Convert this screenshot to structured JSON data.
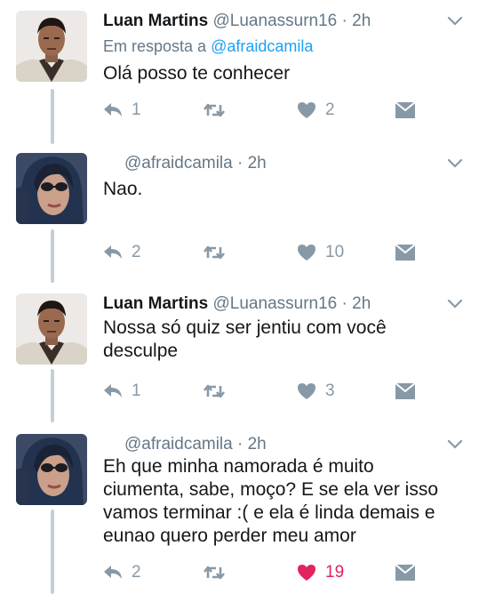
{
  "colors": {
    "accent": "#1da1f2",
    "muted": "#657786",
    "icon": "#8899a6",
    "liked": "#e0245e",
    "thread": "#c4cfd6"
  },
  "tweets": [
    {
      "name": "Luan Martins",
      "handle": "@Luanassurn16",
      "separator": "·",
      "time": "2h",
      "reply_prefix": "Em resposta a",
      "reply_to": "@afraidcamila",
      "text": [
        "Olá posso te conhecer"
      ],
      "counts": {
        "reply": "1",
        "retweet": "",
        "like": "2"
      },
      "liked": false,
      "avatar": "male-avatar"
    },
    {
      "name": "",
      "handle": "@afraidcamila",
      "separator": "·",
      "time": "2h",
      "text": [
        "Nao."
      ],
      "counts": {
        "reply": "2",
        "retweet": "",
        "like": "10"
      },
      "liked": false,
      "avatar": "female-avatar"
    },
    {
      "name": "Luan Martins",
      "handle": "@Luanassurn16",
      "separator": "·",
      "time": "2h",
      "text": [
        "Nossa só quiz ser jentiu com você",
        "desculpe"
      ],
      "counts": {
        "reply": "1",
        "retweet": "",
        "like": "3"
      },
      "liked": false,
      "avatar": "male-avatar"
    },
    {
      "name": "",
      "handle": "@afraidcamila",
      "separator": "·",
      "time": "2h",
      "text": [
        "Eh que minha namorada é muito",
        "ciumenta, sabe, moço? E se ela ver isso",
        "vamos terminar :( e ela é linda demais e",
        "eunao quero perder meu amor"
      ],
      "counts": {
        "reply": "2",
        "retweet": "",
        "like": "19"
      },
      "liked": true,
      "avatar": "female-avatar"
    }
  ]
}
